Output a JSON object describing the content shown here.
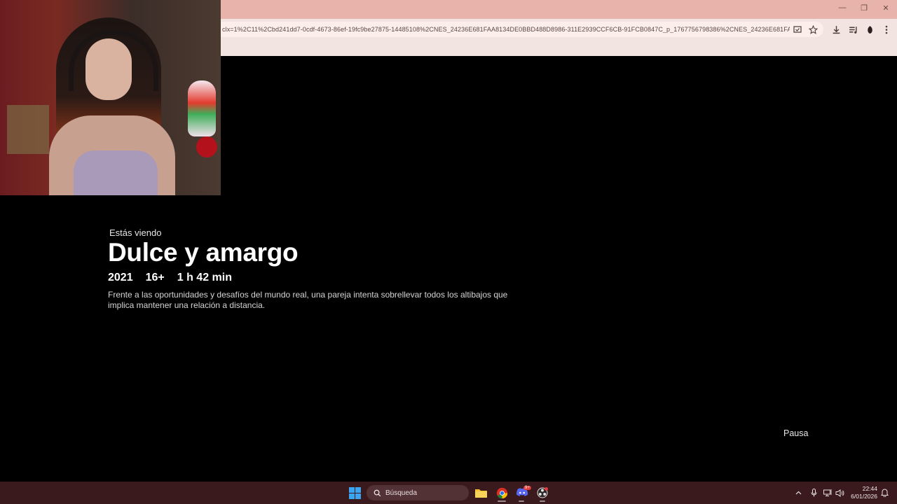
{
  "browser": {
    "url": "clx=1%2C11%2Cbd241dd7-0cdf-4673-86ef-19fc9be27875-14485108%2CNES_24236E681FAA8134DE0BBD488D8986-311E2939CCF6CB-91FCB0847C_p_1767756798386%2CNES_24236E681FAA81...",
    "window_controls": [
      "—",
      "❐",
      "✕"
    ]
  },
  "content": {
    "watching_label": "Estás viendo",
    "title": "Dulce y amargo",
    "year": "2021",
    "rating": "16+",
    "duration": "1 h 42 min",
    "description": "Frente a las oportunidades y desafíos del mundo real, una pareja intenta sobrellevar todos los altibajos que implica mantener una relación a distancia.",
    "pause_label": "Pausa"
  },
  "taskbar": {
    "search_placeholder": "Búsqueda",
    "time": "22:44",
    "date": "6/01/2026",
    "discord_badge": "9+",
    "apps": [
      "file-explorer",
      "chrome",
      "discord",
      "obs"
    ]
  },
  "colors": {
    "titlebar": "#e8b3aa",
    "toolbar": "#f1e4e1",
    "taskbar": "#3a1a1c",
    "background": "#000000"
  }
}
